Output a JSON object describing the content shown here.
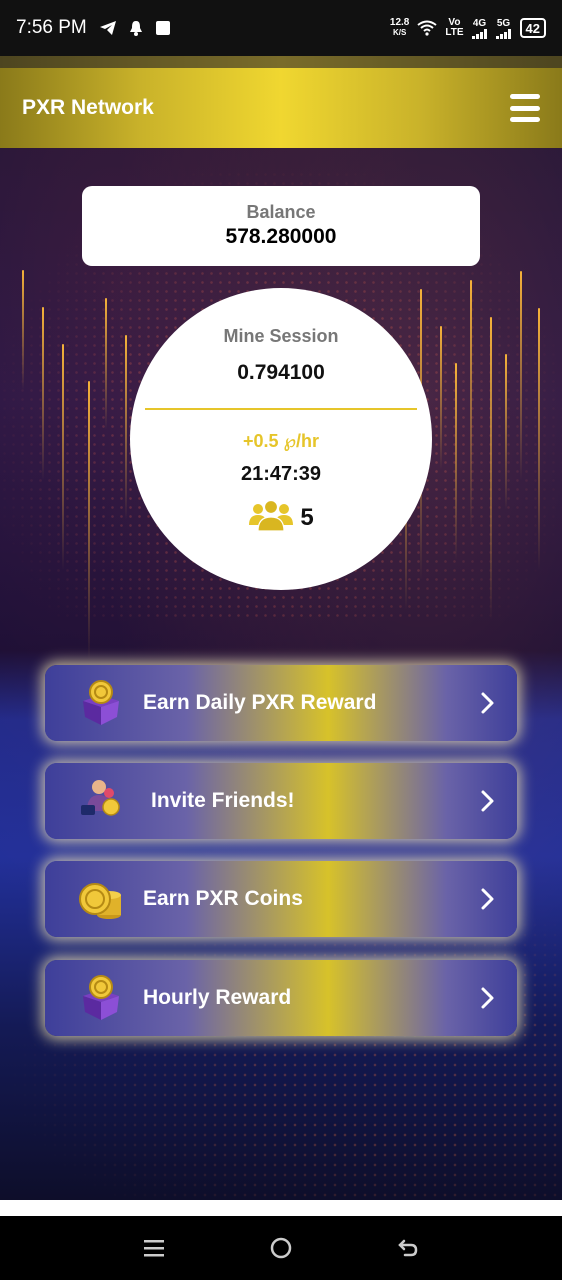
{
  "status_bar": {
    "time": "7:56 PM",
    "net_speed_value": "12.8",
    "net_speed_unit": "K/S",
    "volte_top": "Vo",
    "volte_bottom": "LTE",
    "sim1": "4G",
    "sim2": "5G",
    "battery": "42",
    "icons": [
      "telegram-icon",
      "notification-bell-icon",
      "app-square-icon",
      "wifi-icon",
      "signal-icon"
    ]
  },
  "header": {
    "title": "PXR Network",
    "menu_icon": "hamburger-menu-icon"
  },
  "balance": {
    "label": "Balance",
    "value": "578.280000"
  },
  "mine": {
    "label": "Mine Session",
    "value": "0.794100",
    "rate": "+0.5 ℘/hr",
    "timer": "21:47:39",
    "users_count": "5",
    "users_icon": "users-group-icon"
  },
  "actions": [
    {
      "label": "Earn Daily PXR Reward",
      "icon": "reward-box-icon"
    },
    {
      "label": "Invite Friends!",
      "icon": "invite-friends-icon"
    },
    {
      "label": "Earn PXR Coins",
      "icon": "coin-stack-icon"
    },
    {
      "label": "Hourly Reward",
      "icon": "reward-box-icon"
    }
  ],
  "colors": {
    "accent_gold": "#e6c52a",
    "button_blue": "#3e3f9a",
    "header_gold": "#f0d730"
  },
  "nav_bar": [
    "recent-apps-icon",
    "home-icon",
    "back-icon"
  ]
}
